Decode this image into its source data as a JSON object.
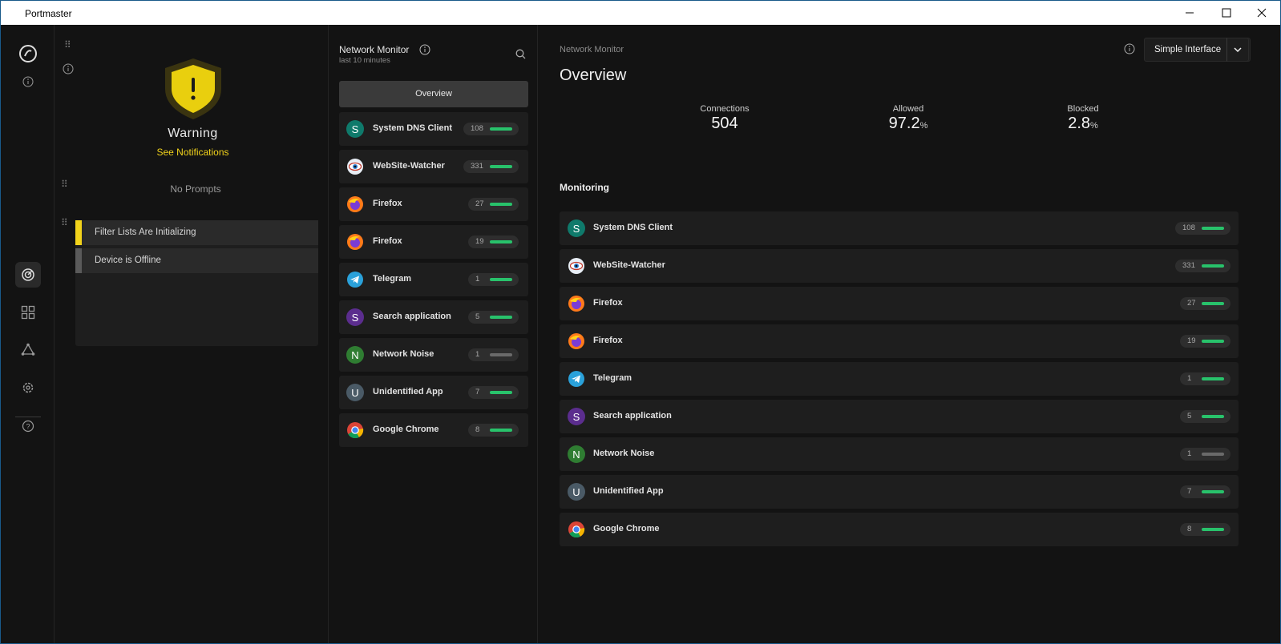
{
  "window": {
    "title": "Portmaster"
  },
  "colors": {
    "accent_green": "#28c26b",
    "warning_yellow": "#f2d31b",
    "idle_grey": "#6a6a6a"
  },
  "rail": {
    "icons": [
      "portmaster-logo-icon",
      "info-icon",
      "monitor-icon",
      "apps-icon",
      "spn-icon",
      "settings-icon",
      "help-icon"
    ]
  },
  "dashboard": {
    "status_title": "Warning",
    "status_link": "See Notifications",
    "prompts_text": "No Prompts",
    "notifications": [
      {
        "label": "Filter Lists Are Initializing",
        "level_color": "#f2d31b"
      },
      {
        "label": "Device is Offline",
        "level_color": "#5a5a5a"
      }
    ]
  },
  "network_monitor": {
    "title": "Network Monitor",
    "subtitle": "last 10 minutes",
    "overview_label": "Overview",
    "apps": [
      {
        "name": "System DNS Client",
        "count": "108",
        "icon": "S",
        "icon_color": "#0f7a6b",
        "active": true
      },
      {
        "name": "WebSite-Watcher",
        "count": "331",
        "icon": "website-watcher-icon",
        "icon_color": "#2d7fd6",
        "active": true
      },
      {
        "name": "Firefox",
        "count": "27",
        "icon": "firefox-icon",
        "icon_color": "#ff7a1a",
        "active": true
      },
      {
        "name": "Firefox",
        "count": "19",
        "icon": "firefox-icon",
        "icon_color": "#ff7a1a",
        "active": true
      },
      {
        "name": "Telegram",
        "count": "1",
        "icon": "telegram-icon",
        "icon_color": "#2aa1da",
        "active": true
      },
      {
        "name": "Search application",
        "count": "5",
        "icon": "S",
        "icon_color": "#5b2d8e",
        "active": true
      },
      {
        "name": "Network Noise",
        "count": "1",
        "icon": "N",
        "icon_color": "#2f7d32",
        "active": false
      },
      {
        "name": "Unidentified App",
        "count": "7",
        "icon": "U",
        "icon_color": "#4a5a66",
        "active": true
      },
      {
        "name": "Google Chrome",
        "count": "8",
        "icon": "chrome-icon",
        "icon_color": "#4285f4",
        "active": true
      }
    ]
  },
  "main": {
    "breadcrumb": "Network Monitor",
    "title": "Overview",
    "interface_button": "Simple Interface",
    "stats": {
      "connections_label": "Connections",
      "connections_value": "504",
      "allowed_label": "Allowed",
      "allowed_value": "97.2",
      "allowed_unit": "%",
      "blocked_label": "Blocked",
      "blocked_value": "2.8",
      "blocked_unit": "%"
    },
    "monitoring_title": "Monitoring"
  }
}
